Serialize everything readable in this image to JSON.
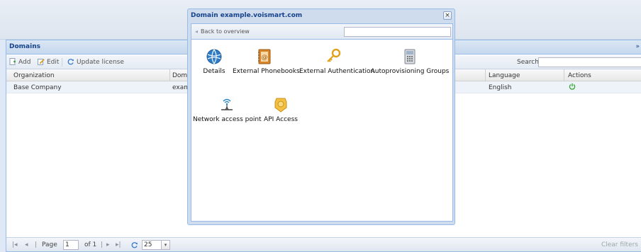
{
  "panel": {
    "title": "Domains",
    "collapse_glyph": "»"
  },
  "toolbar": {
    "add_label": "Add",
    "edit_label": "Edit",
    "update_license_label": "Update license",
    "search_label": "Search",
    "search_value": ""
  },
  "grid": {
    "columns": [
      "Organization",
      "Domai",
      "Language",
      "Actions"
    ],
    "rows": [
      {
        "organization": "Base Company",
        "domain": "examp",
        "language": "English",
        "action_icon": "power-icon"
      }
    ]
  },
  "pager": {
    "page_label": "Page",
    "page_value": "1",
    "of_label": "of 1",
    "page_size": "25",
    "clear_filters_label": "Clear filters"
  },
  "modal": {
    "title": "Domain example.voismart.com",
    "close_glyph": "×",
    "back_label": "Back to overview",
    "search_value": "",
    "items": [
      {
        "label": "Details",
        "icon": "globe-icon"
      },
      {
        "label": "External Phonebooks",
        "icon": "address-book-icon"
      },
      {
        "label": "External Authentication",
        "icon": "key-icon"
      },
      {
        "label": "Autoprovisioning Groups",
        "icon": "phone-device-icon"
      },
      {
        "label": "Network access point",
        "icon": "wifi-antenna-icon"
      },
      {
        "label": "API Access",
        "icon": "badge-icon"
      }
    ]
  },
  "colors": {
    "accent": "#15428b",
    "border": "#99bbe8",
    "row_selected": "#eef3fa",
    "power_green": "#3aa83a"
  }
}
